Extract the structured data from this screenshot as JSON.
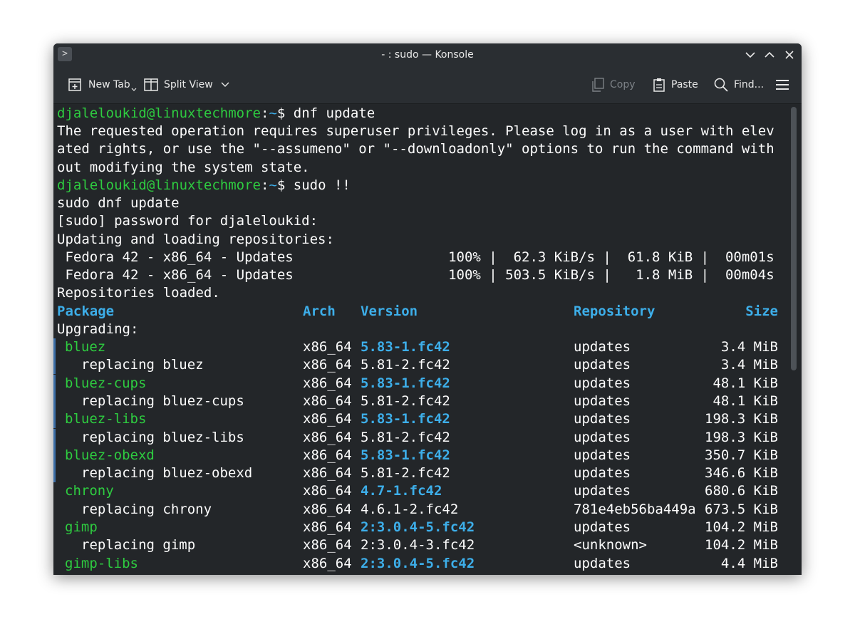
{
  "window": {
    "title": "- : sudo — Konsole",
    "app_icon_glyph": ">"
  },
  "toolbar": {
    "new_tab": "New Tab",
    "split_view": "Split View",
    "copy": "Copy",
    "paste": "Paste",
    "find": "Find..."
  },
  "colors": {
    "background": "#232629",
    "prompt_user": "#2ecc40",
    "prompt_path": "#3daee9",
    "header": "#3daee9",
    "package_name": "#2ecc40",
    "new_version": "#3daee9",
    "text": "#fcfcfc"
  },
  "terminal": {
    "prompt1": {
      "user": "djaleloukid@linuxtechmore",
      "sep": ":",
      "path": "~",
      "cmd": "$ dnf update"
    },
    "msg1": "The requested operation requires superuser privileges. Please log in as a user with elev",
    "msg2": "ated rights, or use the \"--assumeno\" or \"--downloadonly\" options to run the command with",
    "msg3": "out modifying the system state.",
    "prompt2": {
      "user": "djaleloukid@linuxtechmore",
      "sep": ":",
      "path": "~",
      "cmd": "$ sudo !!"
    },
    "echo": "sudo dnf update",
    "password": "[sudo] password for djaleloukid:",
    "loading": "Updating and loading repositories:",
    "repo1": " Fedora 42 - x86_64 - Updates                   100% |  62.3 KiB/s |  61.8 KiB |  00m01s",
    "repo2": " Fedora 42 - x86_64 - Updates                   100% | 503.5 KiB/s |   1.8 MiB |  00m04s",
    "loaded": "Repositories loaded.",
    "headers": {
      "package": "Package",
      "arch": "Arch",
      "version": "Version",
      "repository": "Repository",
      "size": "Size"
    },
    "upgrading": "Upgrading:",
    "rows": [
      {
        "kind": "new",
        "pkg": "bluez",
        "arch": "x86_64",
        "ver": "5.83-1.fc42",
        "repo": "updates",
        "size": "3.4 MiB",
        "marker": true
      },
      {
        "kind": "old",
        "pkg": "replacing bluez",
        "arch": "x86_64",
        "ver": "5.81-2.fc42",
        "repo": "updates",
        "size": "3.4 MiB",
        "marker": true
      },
      {
        "kind": "new",
        "pkg": "bluez-cups",
        "arch": "x86_64",
        "ver": "5.83-1.fc42",
        "repo": "updates",
        "size": "48.1 KiB",
        "marker": true
      },
      {
        "kind": "old",
        "pkg": "replacing bluez-cups",
        "arch": "x86_64",
        "ver": "5.81-2.fc42",
        "repo": "updates",
        "size": "48.1 KiB",
        "marker": true
      },
      {
        "kind": "new",
        "pkg": "bluez-libs",
        "arch": "x86_64",
        "ver": "5.83-1.fc42",
        "repo": "updates",
        "size": "198.3 KiB",
        "marker": true
      },
      {
        "kind": "old",
        "pkg": "replacing bluez-libs",
        "arch": "x86_64",
        "ver": "5.81-2.fc42",
        "repo": "updates",
        "size": "198.3 KiB",
        "marker": true
      },
      {
        "kind": "new",
        "pkg": "bluez-obexd",
        "arch": "x86_64",
        "ver": "5.83-1.fc42",
        "repo": "updates",
        "size": "350.7 KiB",
        "marker": true
      },
      {
        "kind": "old",
        "pkg": "replacing bluez-obexd",
        "arch": "x86_64",
        "ver": "5.81-2.fc42",
        "repo": "updates",
        "size": "346.6 KiB",
        "marker": true
      },
      {
        "kind": "new",
        "pkg": "chrony",
        "arch": "x86_64",
        "ver": "4.7-1.fc42",
        "repo": "updates",
        "size": "680.6 KiB",
        "marker": false
      },
      {
        "kind": "old",
        "pkg": "replacing chrony",
        "arch": "x86_64",
        "ver": "4.6.1-2.fc42",
        "repo": "781e4eb56ba449a",
        "size": "673.5 KiB",
        "marker": false
      },
      {
        "kind": "new",
        "pkg": "gimp",
        "arch": "x86_64",
        "ver": "2:3.0.4-5.fc42",
        "repo": "updates",
        "size": "104.2 MiB",
        "marker": false
      },
      {
        "kind": "old",
        "pkg": "replacing gimp",
        "arch": "x86_64",
        "ver": "2:3.0.4-3.fc42",
        "repo": "<unknown>",
        "size": "104.2 MiB",
        "marker": false
      },
      {
        "kind": "new",
        "pkg": "gimp-libs",
        "arch": "x86_64",
        "ver": "2:3.0.4-5.fc42",
        "repo": "updates",
        "size": "4.4 MiB",
        "marker": false
      }
    ]
  }
}
